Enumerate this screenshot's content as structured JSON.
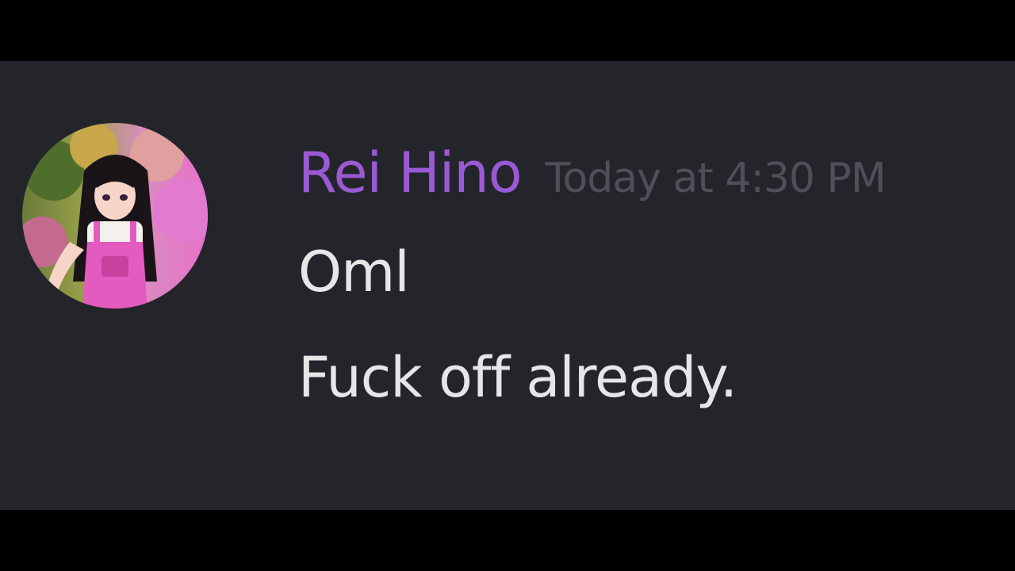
{
  "message": {
    "author": {
      "name": "Rei Hino",
      "name_color": "#9b59d3",
      "avatar": "anime-girl-avatar"
    },
    "timestamp": "Today at 4:30 PM",
    "lines": [
      "Oml",
      "Fuck off already."
    ]
  },
  "colors": {
    "background": "#23252b",
    "letterbox": "#000000",
    "text": "#e6e6e6",
    "timestamp": "#4e5058"
  }
}
